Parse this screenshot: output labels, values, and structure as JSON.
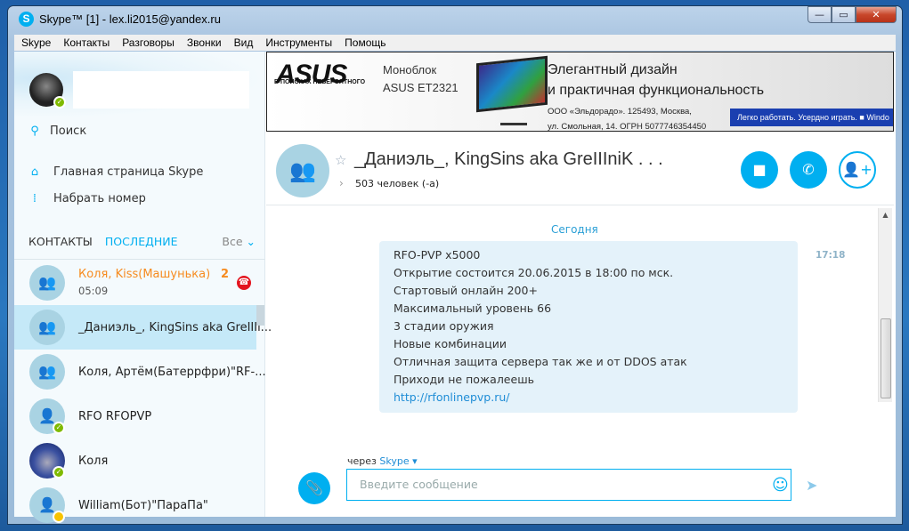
{
  "window": {
    "title": "Skype™ [1] - lex.li2015@yandex.ru",
    "min": "—",
    "max": "▭",
    "close": "✕"
  },
  "menu": [
    "Skype",
    "Контакты",
    "Разговоры",
    "Звонки",
    "Вид",
    "Инструменты",
    "Помощь"
  ],
  "sidebar": {
    "search": "Поиск",
    "home": "Главная страница Skype",
    "dial": "Набрать номер",
    "tab_contacts": "КОНТАКТЫ",
    "tab_recent": "ПОСЛЕДНИЕ",
    "filter": "Все",
    "items": [
      {
        "name": "Коля, Kiss(Машунька)",
        "time": "05:09",
        "unread": "2"
      },
      {
        "name": "_Даниэль_, KingSins aka GreIIIi..."
      },
      {
        "name": "Коля, Артём(Батеррфри)\"RF-..."
      },
      {
        "name": "RFO RFOPVP"
      },
      {
        "name": "Коля"
      },
      {
        "name": "William(Бот)\"ПараПа\""
      }
    ]
  },
  "ad": {
    "brand": "ASUS",
    "slogan": "В ПОИСКАХ НЕВЕРОЯТНОГО",
    "product1": "Моноблок",
    "product2": "ASUS ET2321",
    "head1": "Элегантный дизайн",
    "head2": "и практичная функциональность",
    "legal1": "ООО «Эльдорадо». 125493, Москва,",
    "legal2": "ул. Смольная, 14. ОГРН 5077746354450",
    "band": "Легко работать. Усердно играть.  ■ Windo"
  },
  "chat": {
    "title": "_Даниэль_, KingSins aka GreIIIniK . . .",
    "members": "503 человек (-а)",
    "day": "Сегодня",
    "time": "17:18",
    "message": [
      "RFO-PVP x5000",
      "Открытие состоится 20.06.2015 в 18:00 по мск.",
      "Стартовый онлайн 200+",
      "Максимальный уровень 66",
      "3 стадии оружия",
      "Новые комбинации",
      "Отличная защита сервера так же и от DDOS атак",
      "Приходи не пожалеешь"
    ],
    "link": "http://rfonlinepvp.ru/",
    "via": "через",
    "via_service": "Skype ▾",
    "placeholder": "Введите сообщение"
  }
}
